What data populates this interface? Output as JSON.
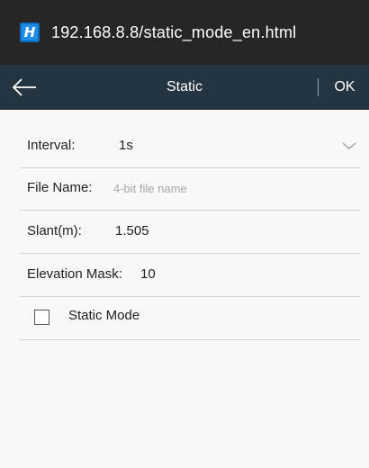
{
  "browser": {
    "url": "192.168.8.8/static_mode_en.html",
    "app_icon_letter": "H",
    "app_icon_color": "#1e8fe6"
  },
  "header": {
    "title": "Static",
    "ok_label": "OK",
    "background_color": "#243440"
  },
  "form": {
    "interval": {
      "label": "Interval:",
      "value": "1s"
    },
    "file_name": {
      "label": "File Name:",
      "placeholder": "4-bit file name",
      "value": ""
    },
    "slant": {
      "label": "Slant(m):",
      "value": "1.505"
    },
    "elevation_mask": {
      "label": "Elevation Mask:",
      "value": "10"
    },
    "static_mode": {
      "label": "Static Mode",
      "checked": false
    }
  }
}
